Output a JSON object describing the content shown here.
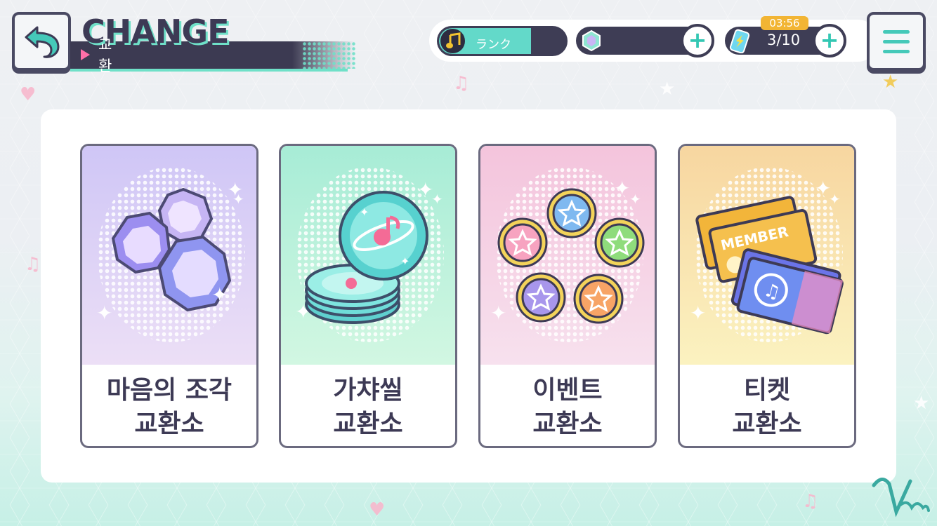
{
  "header": {
    "title_en": "CHANGE",
    "title_ko": "교환"
  },
  "status": {
    "rank_label": "ランク",
    "rank_progress": 0.73,
    "energy_timer": "03:56",
    "energy_count": "3/10"
  },
  "cards": [
    {
      "line1": "마음의 조각",
      "line2": "교환소",
      "gradient_top": "#cfc6f6",
      "gradient_bottom": "#ecdff6"
    },
    {
      "line1": "가챠씰",
      "line2": "교환소",
      "gradient_top": "#a7ecd6",
      "gradient_bottom": "#d2f7e2"
    },
    {
      "line1": "이벤트",
      "line2": "교환소",
      "gradient_top": "#f4c4dc",
      "gradient_bottom": "#f7e1ee"
    },
    {
      "line1": "티켓",
      "line2": "교환소",
      "gradient_top": "#f7d6a0",
      "gradient_bottom": "#fbf2c0"
    }
  ],
  "colors": {
    "accent_teal": "#63d9c9",
    "navy": "#3e3d55",
    "timer_gold": "#f2b534",
    "pink_arrow": "#ff6fa8"
  }
}
